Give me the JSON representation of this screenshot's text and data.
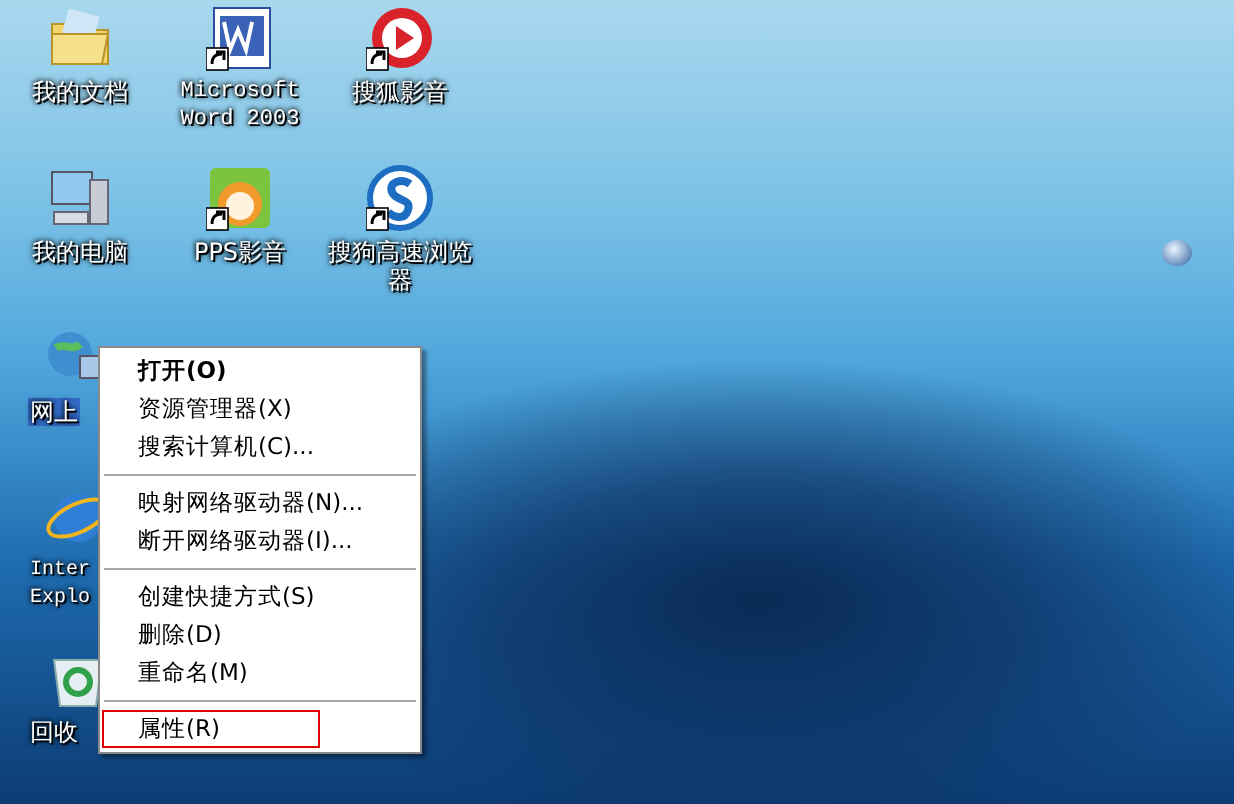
{
  "desktop_icons": [
    {
      "label": "我的文档",
      "kind": "documents",
      "shortcut": false,
      "selected": false,
      "mono": false
    },
    {
      "label": "Microsoft Word 2003",
      "kind": "word",
      "shortcut": true,
      "selected": false,
      "mono": true
    },
    {
      "label": "搜狐影音",
      "kind": "player",
      "shortcut": true,
      "selected": false,
      "mono": false
    },
    {
      "label": "我的电脑",
      "kind": "computer",
      "shortcut": false,
      "selected": false,
      "mono": false
    },
    {
      "label": "PPS影音",
      "kind": "pps",
      "shortcut": true,
      "selected": false,
      "mono": false
    },
    {
      "label": "搜狗高速浏览器",
      "kind": "browser",
      "shortcut": true,
      "selected": false,
      "mono": false
    },
    {
      "label": "网上",
      "kind": "network",
      "shortcut": false,
      "selected": true,
      "mono": false
    },
    {
      "label": "Inter Explo",
      "kind": "ie",
      "shortcut": false,
      "selected": false,
      "mono": true
    },
    {
      "label": "回收",
      "kind": "recycle",
      "shortcut": false,
      "selected": false,
      "mono": false
    }
  ],
  "context_menu": {
    "items": [
      {
        "kind": "item",
        "label": "打开(O)",
        "bold": true,
        "annotated": false
      },
      {
        "kind": "item",
        "label": "资源管理器(X)",
        "bold": false,
        "annotated": false
      },
      {
        "kind": "item",
        "label": "搜索计算机(C)...",
        "bold": false,
        "annotated": false
      },
      {
        "kind": "separator"
      },
      {
        "kind": "item",
        "label": "映射网络驱动器(N)...",
        "bold": false,
        "annotated": false
      },
      {
        "kind": "item",
        "label": "断开网络驱动器(I)...",
        "bold": false,
        "annotated": false
      },
      {
        "kind": "separator"
      },
      {
        "kind": "item",
        "label": "创建快捷方式(S)",
        "bold": false,
        "annotated": false
      },
      {
        "kind": "item",
        "label": "删除(D)",
        "bold": false,
        "annotated": false
      },
      {
        "kind": "item",
        "label": "重命名(M)",
        "bold": false,
        "annotated": false
      },
      {
        "kind": "separator"
      },
      {
        "kind": "item",
        "label": "属性(R)",
        "bold": false,
        "annotated": true
      }
    ]
  }
}
